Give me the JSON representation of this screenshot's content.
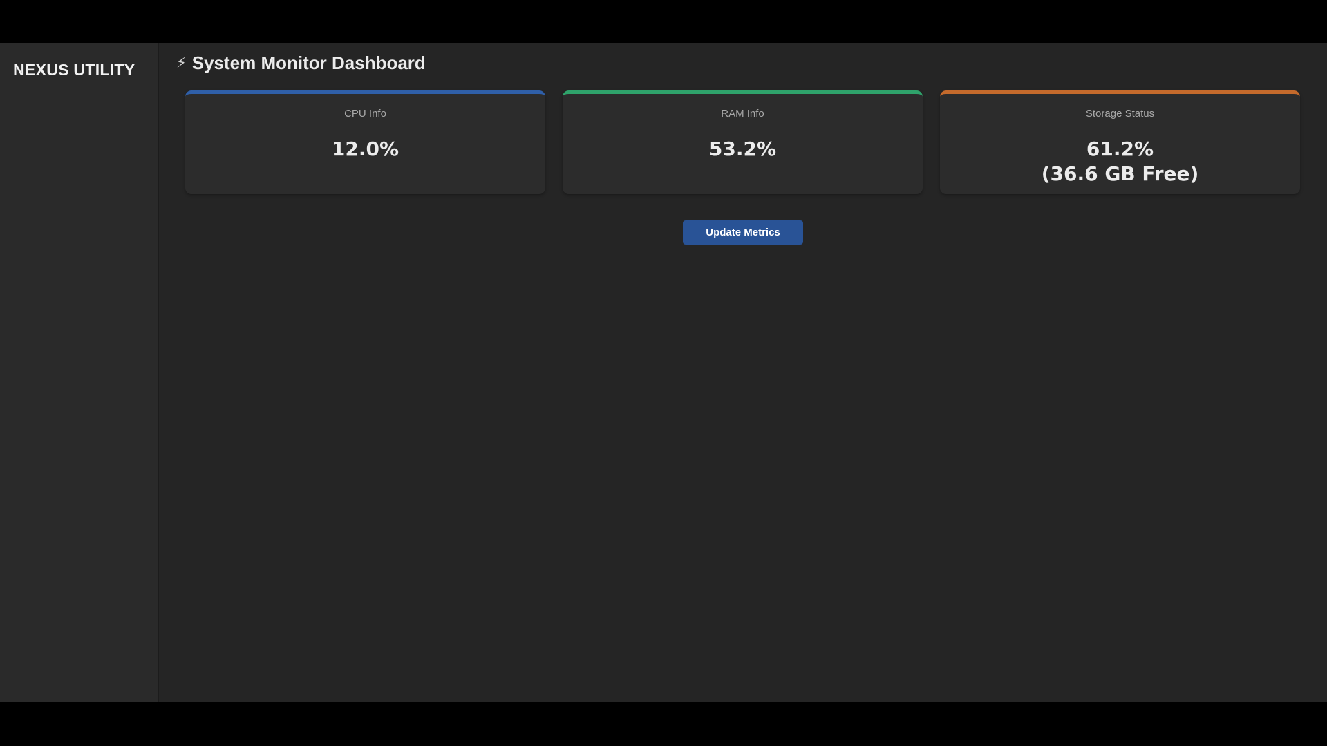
{
  "sidebar": {
    "brand": "NEXUS UTILITY"
  },
  "header": {
    "icon": "lightning-bolt-icon",
    "title": "System Monitor Dashboard"
  },
  "cards": [
    {
      "label": "CPU Info",
      "value": "12.0%",
      "accent": "#2f5fa8"
    },
    {
      "label": "RAM Info",
      "value": "53.2%",
      "accent": "#2fa36b"
    },
    {
      "label": "Storage Status",
      "value": "61.2%",
      "value_line2": "(36.6 GB Free)",
      "accent": "#c46a2c"
    }
  ],
  "actions": {
    "update_label": "Update Metrics"
  },
  "colors": {
    "background": "#252525",
    "sidebar": "#2a2a2a",
    "card": "#2c2c2c",
    "button": "#295396"
  }
}
